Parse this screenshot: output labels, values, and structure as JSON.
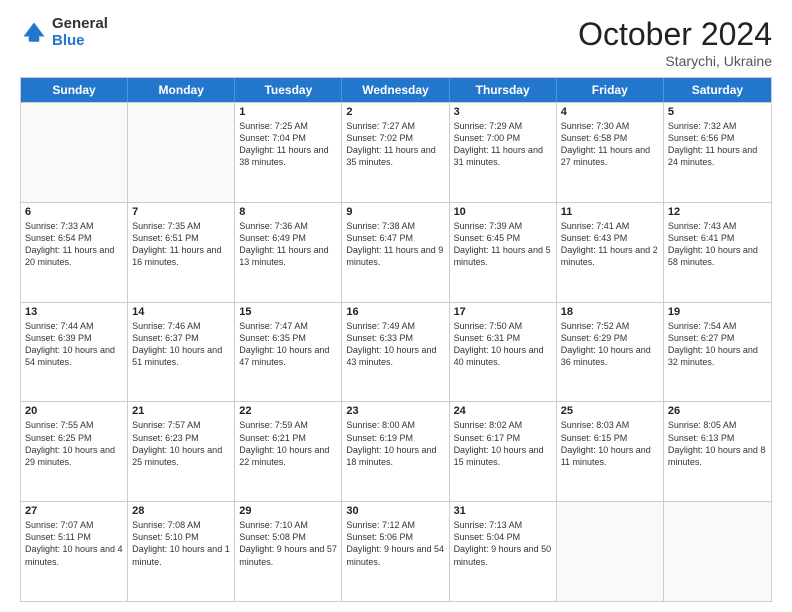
{
  "logo": {
    "general": "General",
    "blue": "Blue"
  },
  "header": {
    "month": "October 2024",
    "location": "Starychi, Ukraine"
  },
  "days_of_week": [
    "Sunday",
    "Monday",
    "Tuesday",
    "Wednesday",
    "Thursday",
    "Friday",
    "Saturday"
  ],
  "weeks": [
    [
      {
        "day": "",
        "sunrise": "",
        "sunset": "",
        "daylight": ""
      },
      {
        "day": "",
        "sunrise": "",
        "sunset": "",
        "daylight": ""
      },
      {
        "day": "1",
        "sunrise": "Sunrise: 7:25 AM",
        "sunset": "Sunset: 7:04 PM",
        "daylight": "Daylight: 11 hours and 38 minutes."
      },
      {
        "day": "2",
        "sunrise": "Sunrise: 7:27 AM",
        "sunset": "Sunset: 7:02 PM",
        "daylight": "Daylight: 11 hours and 35 minutes."
      },
      {
        "day": "3",
        "sunrise": "Sunrise: 7:29 AM",
        "sunset": "Sunset: 7:00 PM",
        "daylight": "Daylight: 11 hours and 31 minutes."
      },
      {
        "day": "4",
        "sunrise": "Sunrise: 7:30 AM",
        "sunset": "Sunset: 6:58 PM",
        "daylight": "Daylight: 11 hours and 27 minutes."
      },
      {
        "day": "5",
        "sunrise": "Sunrise: 7:32 AM",
        "sunset": "Sunset: 6:56 PM",
        "daylight": "Daylight: 11 hours and 24 minutes."
      }
    ],
    [
      {
        "day": "6",
        "sunrise": "Sunrise: 7:33 AM",
        "sunset": "Sunset: 6:54 PM",
        "daylight": "Daylight: 11 hours and 20 minutes."
      },
      {
        "day": "7",
        "sunrise": "Sunrise: 7:35 AM",
        "sunset": "Sunset: 6:51 PM",
        "daylight": "Daylight: 11 hours and 16 minutes."
      },
      {
        "day": "8",
        "sunrise": "Sunrise: 7:36 AM",
        "sunset": "Sunset: 6:49 PM",
        "daylight": "Daylight: 11 hours and 13 minutes."
      },
      {
        "day": "9",
        "sunrise": "Sunrise: 7:38 AM",
        "sunset": "Sunset: 6:47 PM",
        "daylight": "Daylight: 11 hours and 9 minutes."
      },
      {
        "day": "10",
        "sunrise": "Sunrise: 7:39 AM",
        "sunset": "Sunset: 6:45 PM",
        "daylight": "Daylight: 11 hours and 5 minutes."
      },
      {
        "day": "11",
        "sunrise": "Sunrise: 7:41 AM",
        "sunset": "Sunset: 6:43 PM",
        "daylight": "Daylight: 11 hours and 2 minutes."
      },
      {
        "day": "12",
        "sunrise": "Sunrise: 7:43 AM",
        "sunset": "Sunset: 6:41 PM",
        "daylight": "Daylight: 10 hours and 58 minutes."
      }
    ],
    [
      {
        "day": "13",
        "sunrise": "Sunrise: 7:44 AM",
        "sunset": "Sunset: 6:39 PM",
        "daylight": "Daylight: 10 hours and 54 minutes."
      },
      {
        "day": "14",
        "sunrise": "Sunrise: 7:46 AM",
        "sunset": "Sunset: 6:37 PM",
        "daylight": "Daylight: 10 hours and 51 minutes."
      },
      {
        "day": "15",
        "sunrise": "Sunrise: 7:47 AM",
        "sunset": "Sunset: 6:35 PM",
        "daylight": "Daylight: 10 hours and 47 minutes."
      },
      {
        "day": "16",
        "sunrise": "Sunrise: 7:49 AM",
        "sunset": "Sunset: 6:33 PM",
        "daylight": "Daylight: 10 hours and 43 minutes."
      },
      {
        "day": "17",
        "sunrise": "Sunrise: 7:50 AM",
        "sunset": "Sunset: 6:31 PM",
        "daylight": "Daylight: 10 hours and 40 minutes."
      },
      {
        "day": "18",
        "sunrise": "Sunrise: 7:52 AM",
        "sunset": "Sunset: 6:29 PM",
        "daylight": "Daylight: 10 hours and 36 minutes."
      },
      {
        "day": "19",
        "sunrise": "Sunrise: 7:54 AM",
        "sunset": "Sunset: 6:27 PM",
        "daylight": "Daylight: 10 hours and 32 minutes."
      }
    ],
    [
      {
        "day": "20",
        "sunrise": "Sunrise: 7:55 AM",
        "sunset": "Sunset: 6:25 PM",
        "daylight": "Daylight: 10 hours and 29 minutes."
      },
      {
        "day": "21",
        "sunrise": "Sunrise: 7:57 AM",
        "sunset": "Sunset: 6:23 PM",
        "daylight": "Daylight: 10 hours and 25 minutes."
      },
      {
        "day": "22",
        "sunrise": "Sunrise: 7:59 AM",
        "sunset": "Sunset: 6:21 PM",
        "daylight": "Daylight: 10 hours and 22 minutes."
      },
      {
        "day": "23",
        "sunrise": "Sunrise: 8:00 AM",
        "sunset": "Sunset: 6:19 PM",
        "daylight": "Daylight: 10 hours and 18 minutes."
      },
      {
        "day": "24",
        "sunrise": "Sunrise: 8:02 AM",
        "sunset": "Sunset: 6:17 PM",
        "daylight": "Daylight: 10 hours and 15 minutes."
      },
      {
        "day": "25",
        "sunrise": "Sunrise: 8:03 AM",
        "sunset": "Sunset: 6:15 PM",
        "daylight": "Daylight: 10 hours and 11 minutes."
      },
      {
        "day": "26",
        "sunrise": "Sunrise: 8:05 AM",
        "sunset": "Sunset: 6:13 PM",
        "daylight": "Daylight: 10 hours and 8 minutes."
      }
    ],
    [
      {
        "day": "27",
        "sunrise": "Sunrise: 7:07 AM",
        "sunset": "Sunset: 5:11 PM",
        "daylight": "Daylight: 10 hours and 4 minutes."
      },
      {
        "day": "28",
        "sunrise": "Sunrise: 7:08 AM",
        "sunset": "Sunset: 5:10 PM",
        "daylight": "Daylight: 10 hours and 1 minute."
      },
      {
        "day": "29",
        "sunrise": "Sunrise: 7:10 AM",
        "sunset": "Sunset: 5:08 PM",
        "daylight": "Daylight: 9 hours and 57 minutes."
      },
      {
        "day": "30",
        "sunrise": "Sunrise: 7:12 AM",
        "sunset": "Sunset: 5:06 PM",
        "daylight": "Daylight: 9 hours and 54 minutes."
      },
      {
        "day": "31",
        "sunrise": "Sunrise: 7:13 AM",
        "sunset": "Sunset: 5:04 PM",
        "daylight": "Daylight: 9 hours and 50 minutes."
      },
      {
        "day": "",
        "sunrise": "",
        "sunset": "",
        "daylight": ""
      },
      {
        "day": "",
        "sunrise": "",
        "sunset": "",
        "daylight": ""
      }
    ]
  ]
}
